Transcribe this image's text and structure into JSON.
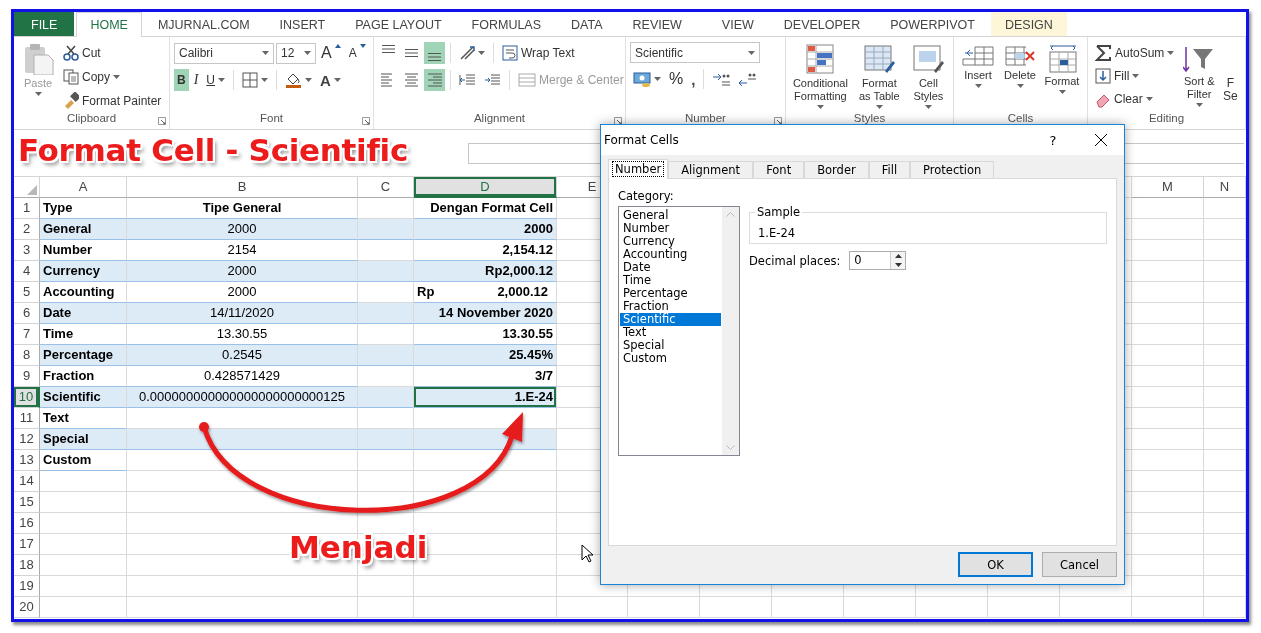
{
  "tabs": [
    {
      "label": "FILE",
      "selected": false,
      "kind": "file"
    },
    {
      "label": "HOME",
      "selected": true,
      "kind": "normal"
    },
    {
      "label": "MJURNAL.COM",
      "selected": false,
      "kind": "normal"
    },
    {
      "label": "INSERT",
      "selected": false,
      "kind": "normal"
    },
    {
      "label": "PAGE LAYOUT",
      "selected": false,
      "kind": "normal"
    },
    {
      "label": "FORMULAS",
      "selected": false,
      "kind": "normal"
    },
    {
      "label": "DATA",
      "selected": false,
      "kind": "normal"
    },
    {
      "label": "REVIEW",
      "selected": false,
      "kind": "normal"
    },
    {
      "label": "VIEW",
      "selected": false,
      "kind": "normal"
    },
    {
      "label": "DEVELOPER",
      "selected": false,
      "kind": "normal"
    },
    {
      "label": "POWERPIVOT",
      "selected": false,
      "kind": "normal"
    },
    {
      "label": "DESIGN",
      "selected": false,
      "kind": "contextual"
    }
  ],
  "ribbon": {
    "clipboard": {
      "title": "Clipboard",
      "paste": "Paste",
      "paste_disabled": true,
      "cut": "Cut",
      "copy": "Copy",
      "format_painter": "Format Painter"
    },
    "font": {
      "title": "Font",
      "name": "Calibri",
      "size": "12",
      "grow": "A",
      "shrink": "A",
      "bold": {
        "label": "B",
        "on": true
      },
      "italic": {
        "label": "I",
        "on": false
      },
      "underline": {
        "label": "U",
        "on": false
      },
      "font_color": "A"
    },
    "alignment": {
      "title": "Alignment",
      "align_top": false,
      "align_middle": false,
      "align_bottom": true,
      "align_left": false,
      "align_center": false,
      "align_right": true,
      "wrap_text": "Wrap Text",
      "merge_center": "Merge & Center",
      "merge_disabled": true
    },
    "number": {
      "title": "Number",
      "format": "Scientific",
      "percent": "%",
      "comma": ","
    },
    "styles": {
      "title": "Styles",
      "conditional_formatting": "Conditional Formatting",
      "format_as_table": "Format as Table",
      "cell_styles": "Cell Styles"
    },
    "cells": {
      "title": "Cells",
      "insert": "Insert",
      "delete": "Delete",
      "format": "Format"
    },
    "editing": {
      "title": "Editing",
      "autosum": "AutoSum",
      "fill": "Fill",
      "clear": "Clear",
      "sort_filter": "Sort & Filter",
      "find_select": [
        "F",
        "Se"
      ]
    }
  },
  "annotations": {
    "title": "Format Cell - Scientific",
    "caption": "Menjadi"
  },
  "sheet": {
    "columns_left": [
      "A",
      "B",
      "C",
      "D",
      "E"
    ],
    "columns_right": [
      "M",
      "N"
    ],
    "rows": [
      {
        "n": "1",
        "kind": "header",
        "shaded": false,
        "a": "Type",
        "b": "Tipe General",
        "d": "Dengan Format Cell",
        "d_selected": false
      },
      {
        "n": "2",
        "kind": "data",
        "shaded": true,
        "a": "General",
        "b": "2000",
        "d": "2000",
        "d_selected": false
      },
      {
        "n": "3",
        "kind": "data",
        "shaded": false,
        "a": "Number",
        "b": "2154",
        "d": "2,154.12",
        "d_selected": false
      },
      {
        "n": "4",
        "kind": "data",
        "shaded": true,
        "a": "Currency",
        "b": "2000",
        "d": "Rp2,000.12",
        "d_selected": false
      },
      {
        "n": "5",
        "kind": "data",
        "shaded": false,
        "a": "Accounting",
        "b": "2000",
        "d_prefix": "Rp",
        "d": "2,000.12",
        "d_selected": false
      },
      {
        "n": "6",
        "kind": "data",
        "shaded": true,
        "a": "Date",
        "b": "14/11/2020",
        "d": "14 November 2020",
        "d_selected": false
      },
      {
        "n": "7",
        "kind": "data",
        "shaded": false,
        "a": "Time",
        "b": "13.30.55",
        "d": "13.30.55",
        "d_selected": false
      },
      {
        "n": "8",
        "kind": "data",
        "shaded": true,
        "a": "Percentage",
        "b": "0.2545",
        "d": "25.45%",
        "d_selected": false
      },
      {
        "n": "9",
        "kind": "data",
        "shaded": false,
        "a": "Fraction",
        "b": "0.428571429",
        "d": "3/7",
        "d_selected": false
      },
      {
        "n": "10",
        "kind": "data",
        "shaded": true,
        "a": "Scientific",
        "b": "0.000000000000000000000000125",
        "d": "1.E-24",
        "d_selected": true
      },
      {
        "n": "11",
        "kind": "data",
        "shaded": false,
        "a": "Text",
        "d_selected": false
      },
      {
        "n": "12",
        "kind": "data",
        "shaded": true,
        "a": "Special",
        "d_selected": false
      },
      {
        "n": "13",
        "kind": "data",
        "shaded": false,
        "a": "Custom",
        "d_selected": false
      }
    ],
    "empty_rows": [
      "14",
      "15",
      "16",
      "17",
      "18",
      "19",
      "20"
    ]
  },
  "dialog": {
    "title": "Format Cells",
    "help": "?",
    "tabs": [
      {
        "label": "Number",
        "selected": true
      },
      {
        "label": "Alignment",
        "selected": false
      },
      {
        "label": "Font",
        "selected": false
      },
      {
        "label": "Border",
        "selected": false
      },
      {
        "label": "Fill",
        "selected": false
      },
      {
        "label": "Protection",
        "selected": false
      }
    ],
    "category_label": "Category:",
    "categories": [
      {
        "label": "General",
        "selected": false
      },
      {
        "label": "Number",
        "selected": false
      },
      {
        "label": "Currency",
        "selected": false
      },
      {
        "label": "Accounting",
        "selected": false
      },
      {
        "label": "Date",
        "selected": false
      },
      {
        "label": "Time",
        "selected": false
      },
      {
        "label": "Percentage",
        "selected": false
      },
      {
        "label": "Fraction",
        "selected": false
      },
      {
        "label": "Scientific",
        "selected": true
      },
      {
        "label": "Text",
        "selected": false
      },
      {
        "label": "Special",
        "selected": false
      },
      {
        "label": "Custom",
        "selected": false
      }
    ],
    "sample_label": "Sample",
    "sample": "1.E-24",
    "decimal_label": "Decimal places:",
    "decimal_value": "0",
    "buttons": [
      {
        "label": "OK",
        "default": true
      },
      {
        "label": "Cancel",
        "default": false
      }
    ]
  }
}
